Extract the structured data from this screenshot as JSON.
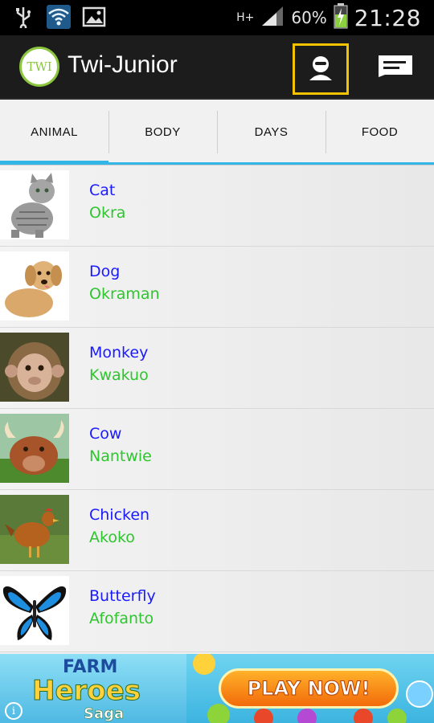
{
  "status_bar": {
    "left_icons": [
      "usb-icon",
      "wifi-icon",
      "image-icon"
    ],
    "network": "H+",
    "battery_percent": "60%",
    "time": "21:28"
  },
  "action_bar": {
    "logo_text": "TWI",
    "title": "Twi-Junior",
    "profile_icon": "profile-icon",
    "chat_icon": "chat-icon",
    "highlight_color": "#f3c200"
  },
  "tabs": [
    {
      "label": "ANIMAL",
      "active": true
    },
    {
      "label": "BODY",
      "active": false
    },
    {
      "label": "DAYS",
      "active": false
    },
    {
      "label": "FOOD",
      "active": false
    }
  ],
  "items": [
    {
      "word": "Cat",
      "translation": "Okra",
      "image": "cat"
    },
    {
      "word": "Dog",
      "translation": "Okraman",
      "image": "dog"
    },
    {
      "word": "Monkey",
      "translation": "Kwakuo",
      "image": "monkey"
    },
    {
      "word": "Cow",
      "translation": "Nantwie",
      "image": "cow"
    },
    {
      "word": "Chicken",
      "translation": "Akoko",
      "image": "chicken"
    },
    {
      "word": "Butterfly",
      "translation": "Afofanto",
      "image": "butterfly"
    }
  ],
  "colors": {
    "word": "#1a1aff",
    "translation": "#2fc52f",
    "tab_indicator": "#33b5e5"
  },
  "ad": {
    "brand_line1": "FARM",
    "brand_line2": "Heroes",
    "brand_line3": "Saga",
    "cta": "PLAY NOW!",
    "info_icon": "i"
  }
}
